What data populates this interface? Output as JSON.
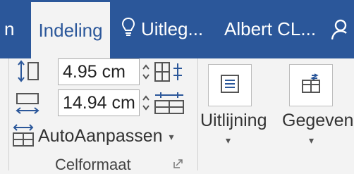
{
  "tabs": [
    {
      "label": "n",
      "active": false
    },
    {
      "label": "Indeling",
      "active": true
    },
    {
      "label": "Uitleg...",
      "active": false
    },
    {
      "label": "Albert CL...",
      "active": false
    }
  ],
  "celformaat": {
    "height_value": "4.95 cm",
    "width_value": "14.94 cm",
    "autofit_label": "AutoAanpassen",
    "group_label": "Celformaat"
  },
  "uitlijning": {
    "label": "Uitlijning"
  },
  "gegevens": {
    "label": "Gegevens"
  },
  "colors": {
    "titlebar": "#2b579a",
    "ribbon": "#f3f3f3",
    "accent": "#2b579a"
  }
}
